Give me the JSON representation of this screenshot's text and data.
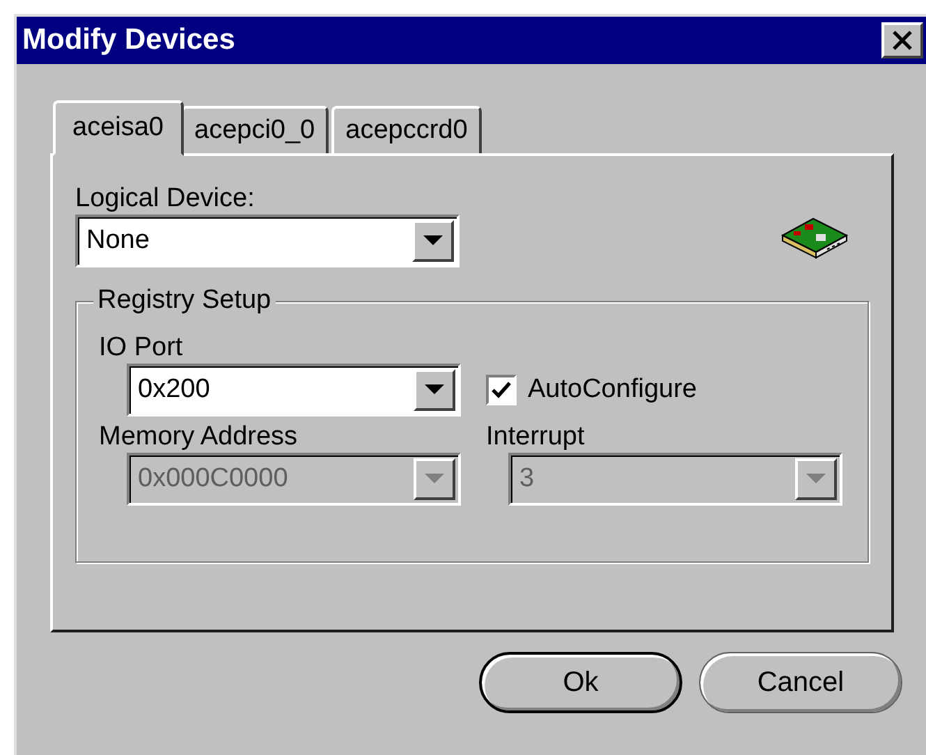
{
  "window": {
    "title": "Modify Devices"
  },
  "tabs": [
    {
      "label": "aceisa0",
      "selected": true
    },
    {
      "label": "acepci0_0",
      "selected": false
    },
    {
      "label": "acepccrd0",
      "selected": false
    }
  ],
  "logical_device": {
    "label": "Logical Device:",
    "value": "None"
  },
  "registry_setup": {
    "title": "Registry Setup",
    "io_port": {
      "label": "IO Port",
      "value": "0x200",
      "disabled": false
    },
    "auto_configure": {
      "label": "AutoConfigure",
      "checked": true
    },
    "memory_address": {
      "label": "Memory Address",
      "value": "0x000C0000",
      "disabled": true
    },
    "interrupt": {
      "label": "Interrupt",
      "value": "3",
      "disabled": true
    }
  },
  "buttons": [
    {
      "label": "Ok",
      "default": true
    },
    {
      "label": "Cancel",
      "default": false
    }
  ]
}
